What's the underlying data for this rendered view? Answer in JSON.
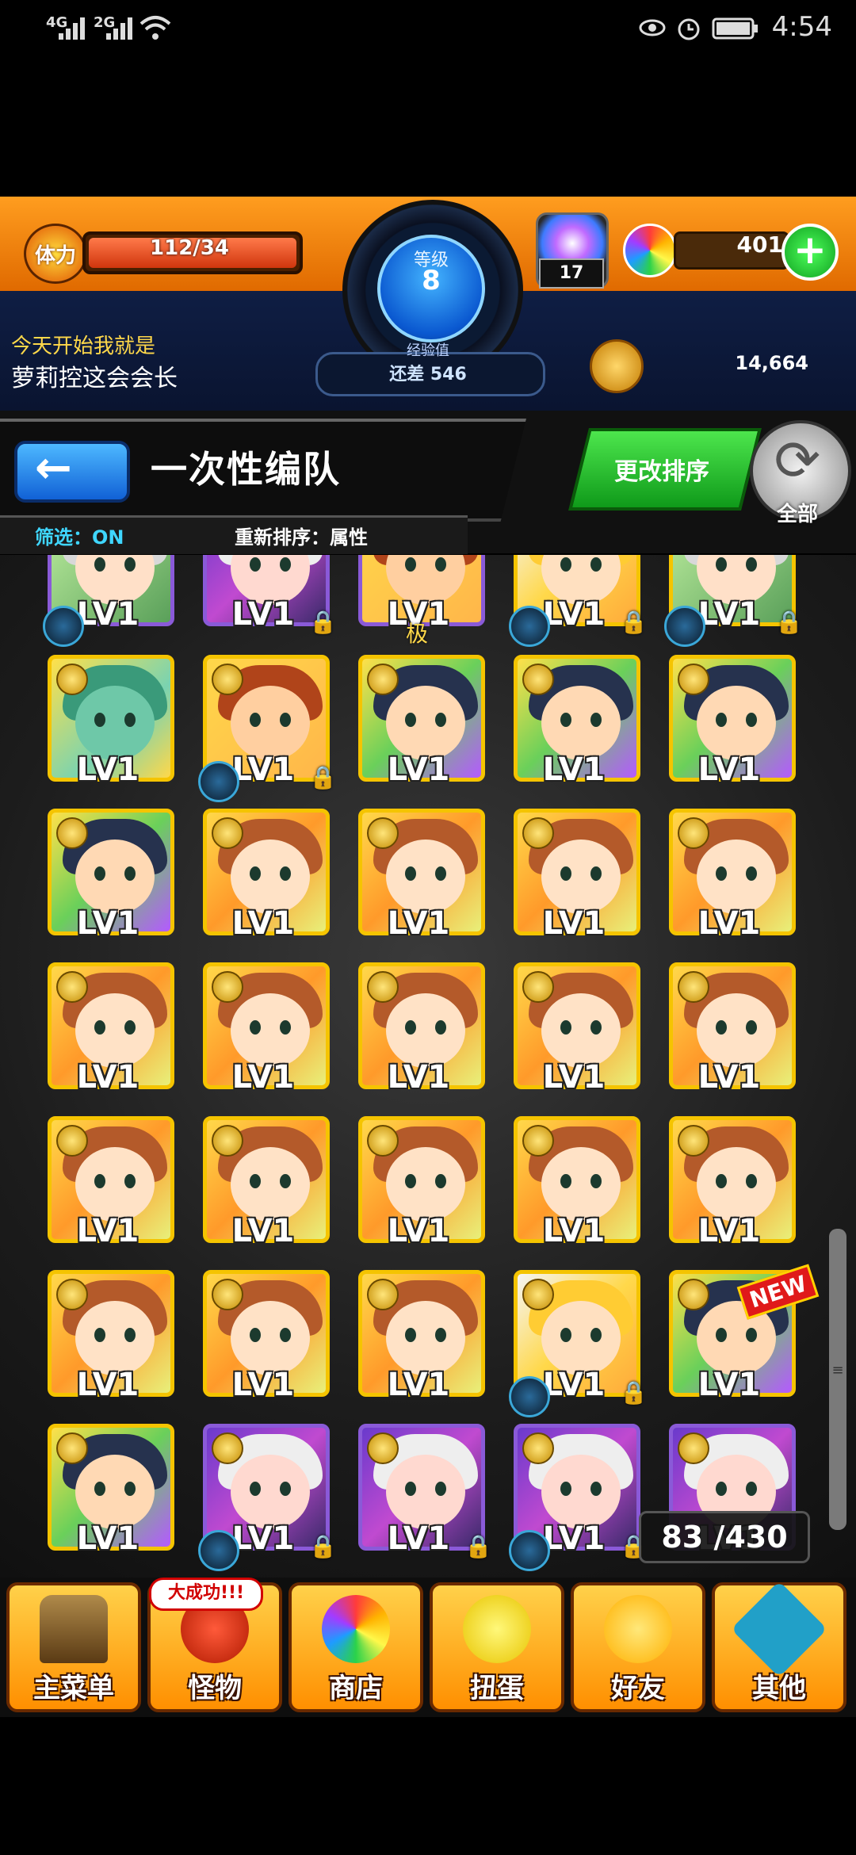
{
  "status_bar": {
    "network1": "4G",
    "network2": "2G",
    "time": "4:54"
  },
  "header": {
    "stamina_label": "体力",
    "stamina_value": "112/34",
    "level_label": "等级",
    "level_value": "8",
    "exp_label": "经验值",
    "exp_remaining": "还差 546",
    "orb_box_count": "17",
    "orb_count": "401",
    "orb_add_label": "+",
    "notice_line1": "今天开始我就是",
    "notice_line2": "萝莉控这会会长",
    "gold": "14,664"
  },
  "toolbar": {
    "back_label": "←",
    "title": "一次性编队",
    "sort_label": "更改排序",
    "refresh_label": "全部",
    "filter": "筛选：ON",
    "resort": "重新排序：属性"
  },
  "grid": {
    "level_text": "LV1",
    "count": "83 /430",
    "extra_mark": "极",
    "new_tag": "NEW"
  },
  "bottom_nav": {
    "success_tag": "大成功!!!",
    "items": [
      {
        "label": "主菜单",
        "icon": "gate-icon"
      },
      {
        "label": "怪物",
        "icon": "monster-icon"
      },
      {
        "label": "商店",
        "icon": "orb-icon"
      },
      {
        "label": "扭蛋",
        "icon": "egg-icon"
      },
      {
        "label": "好友",
        "icon": "balloons-icon"
      },
      {
        "label": "其他",
        "icon": "question-icon"
      }
    ]
  },
  "colors": {
    "accent_orange": "#ff9d1f",
    "frame_gold": "#f5c400",
    "sort_green": "#0f9a1a",
    "back_blue": "#1161d6"
  }
}
